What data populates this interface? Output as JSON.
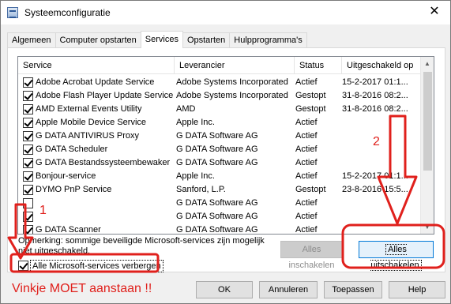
{
  "window": {
    "title": "Systeemconfiguratie",
    "icon": "msconfig-icon",
    "close_glyph": "✕"
  },
  "tabs": [
    {
      "label": "Algemeen",
      "active": false
    },
    {
      "label": "Computer opstarten",
      "active": false
    },
    {
      "label": "Services",
      "active": true
    },
    {
      "label": "Opstarten",
      "active": false
    },
    {
      "label": "Hulpprogramma's",
      "active": false
    }
  ],
  "services": {
    "columns": [
      "Service",
      "Leverancier",
      "Status",
      "Uitgeschakeld op"
    ],
    "rows": [
      {
        "checked": true,
        "service": "Adobe Acrobat Update Service",
        "vendor": "Adobe Systems Incorporated",
        "status": "Actief",
        "disabled_on": "15-2-2017 01:1..."
      },
      {
        "checked": true,
        "service": "Adobe Flash Player Update Service",
        "vendor": "Adobe Systems Incorporated",
        "status": "Gestopt",
        "disabled_on": "31-8-2016 08:2..."
      },
      {
        "checked": true,
        "service": "AMD External Events Utility",
        "vendor": "AMD",
        "status": "Gestopt",
        "disabled_on": "31-8-2016 08:2..."
      },
      {
        "checked": true,
        "service": "Apple Mobile Device Service",
        "vendor": "Apple Inc.",
        "status": "Actief",
        "disabled_on": ""
      },
      {
        "checked": true,
        "service": "G DATA ANTIVIRUS Proxy",
        "vendor": "G DATA Software AG",
        "status": "Actief",
        "disabled_on": ""
      },
      {
        "checked": true,
        "service": "G DATA Scheduler",
        "vendor": "G DATA Software AG",
        "status": "Actief",
        "disabled_on": ""
      },
      {
        "checked": true,
        "service": "G DATA Bestandssysteembewaker",
        "vendor": "G DATA Software AG",
        "status": "Actief",
        "disabled_on": ""
      },
      {
        "checked": true,
        "service": "Bonjour-service",
        "vendor": "Apple Inc.",
        "status": "Actief",
        "disabled_on": "15-2-2017 01:1..."
      },
      {
        "checked": true,
        "service": "DYMO PnP Service",
        "vendor": "Sanford, L.P.",
        "status": "Gestopt",
        "disabled_on": "23-8-2016 15:5..."
      },
      {
        "checked": false,
        "service": "",
        "vendor": "G DATA Software AG",
        "status": "Actief",
        "disabled_on": ""
      },
      {
        "checked": true,
        "service": "",
        "vendor": "G DATA Software AG",
        "status": "Actief",
        "disabled_on": ""
      },
      {
        "checked": true,
        "service": "G DATA Scanner",
        "vendor": "G DATA Software AG",
        "status": "Actief",
        "disabled_on": ""
      }
    ]
  },
  "note": "Opmerking: sommige beveiligde Microsoft-services zijn mogelijk niet uitgeschakeld.",
  "buttons": {
    "enable_all": "Alles inschakelen",
    "disable_all": "Alles uitschakelen",
    "ok": "OK",
    "cancel": "Annuleren",
    "apply": "Toepassen",
    "help": "Help"
  },
  "hide_ms": {
    "label": "Alle Microsoft-services verbergen",
    "checked": true
  },
  "annotations": {
    "label_1": "1",
    "label_2": "2",
    "caption": "Vinkje MOET aanstaan !!",
    "color": "#e0201c"
  }
}
